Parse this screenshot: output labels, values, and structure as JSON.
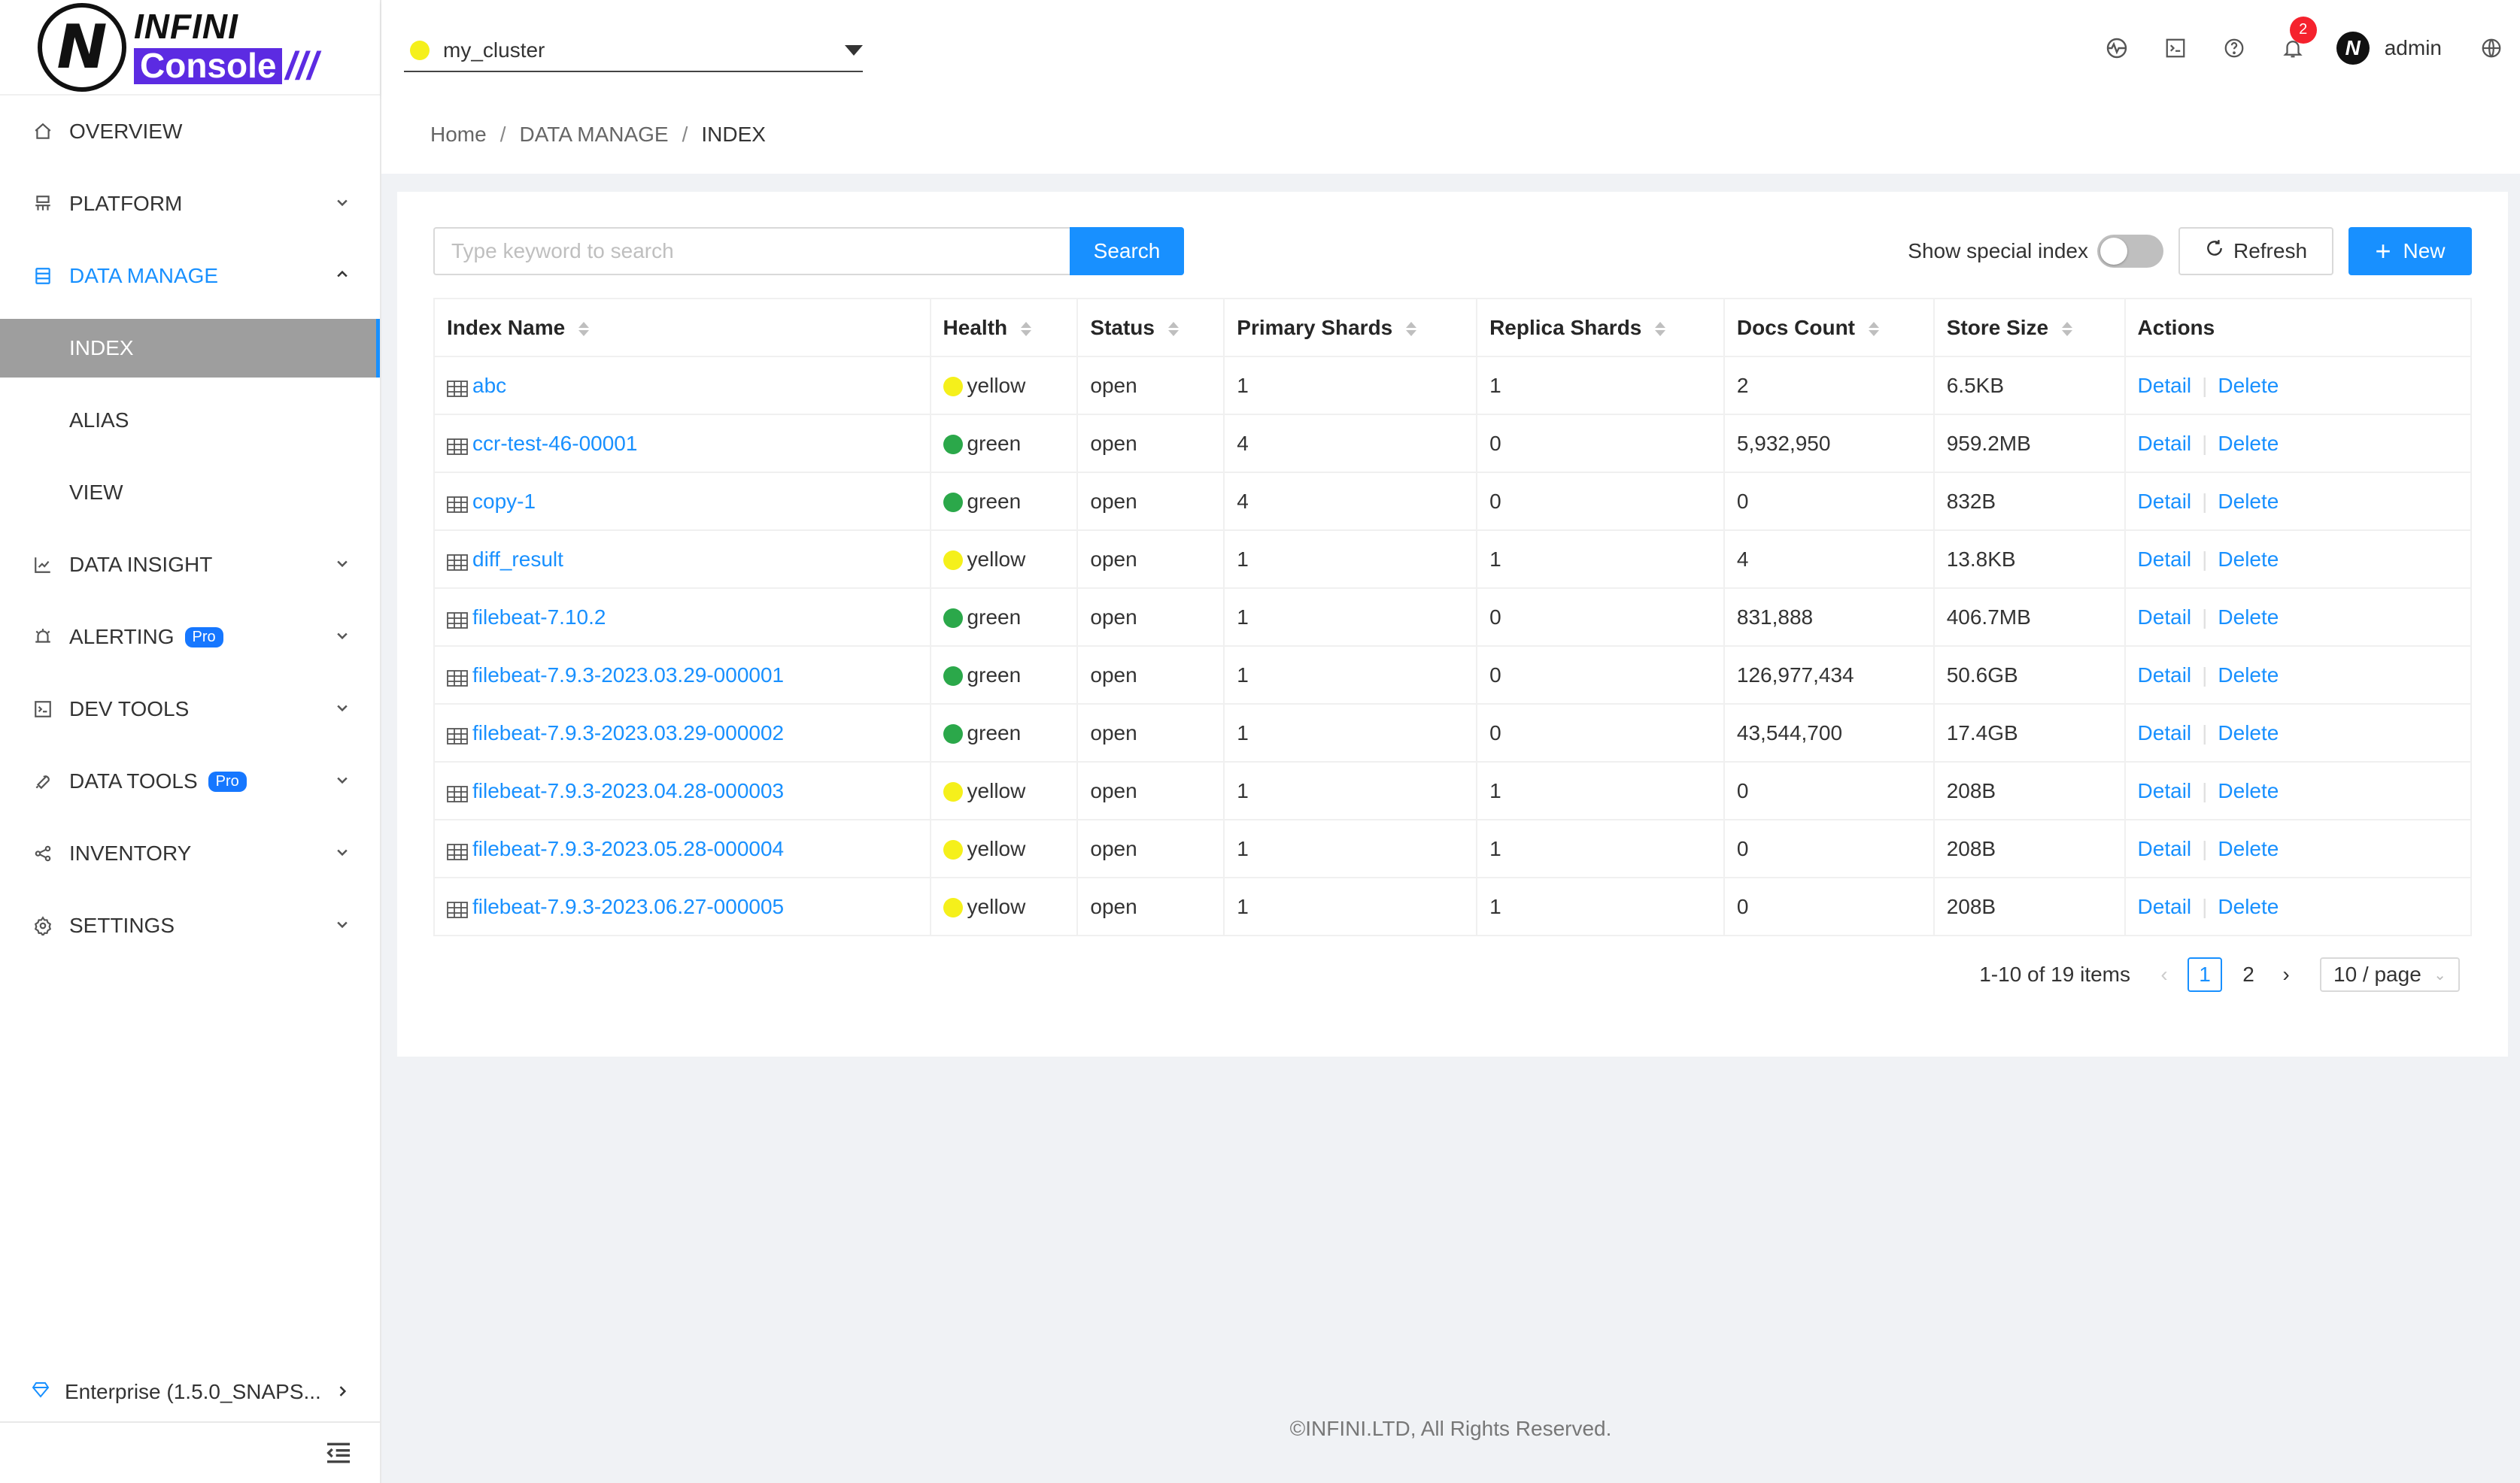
{
  "brand": {
    "top": "INFINI",
    "bottom": "Console",
    "slashes": "///",
    "mark": "N"
  },
  "sidebar": {
    "items": [
      {
        "label": "OVERVIEW",
        "icon": "home-icon"
      },
      {
        "label": "PLATFORM",
        "icon": "platform-icon"
      },
      {
        "label": "DATA MANAGE",
        "icon": "database-icon"
      },
      {
        "label": "DATA INSIGHT",
        "icon": "chart-icon"
      },
      {
        "label": "ALERTING",
        "icon": "alarm-icon",
        "badge": "Pro"
      },
      {
        "label": "DEV TOOLS",
        "icon": "terminal-icon"
      },
      {
        "label": "DATA TOOLS",
        "icon": "wrench-icon",
        "badge": "Pro"
      },
      {
        "label": "INVENTORY",
        "icon": "share-icon"
      },
      {
        "label": "SETTINGS",
        "icon": "gear-icon"
      }
    ],
    "sub_items": [
      "INDEX",
      "ALIAS",
      "VIEW"
    ],
    "footer": "Enterprise (1.5.0_SNAPS..."
  },
  "header": {
    "cluster": "my_cluster",
    "notification_count": "2",
    "user": "admin"
  },
  "breadcrumb": [
    "Home",
    "DATA MANAGE",
    "INDEX"
  ],
  "toolbar": {
    "search_placeholder": "Type keyword to search",
    "search_label": "Search",
    "special_label": "Show special index",
    "refresh_label": "Refresh",
    "new_label": "New"
  },
  "table": {
    "columns": [
      "Index Name",
      "Health",
      "Status",
      "Primary Shards",
      "Replica Shards",
      "Docs Count",
      "Store Size",
      "Actions"
    ],
    "action_labels": {
      "detail": "Detail",
      "delete": "Delete"
    },
    "rows": [
      {
        "name": "abc",
        "health": "yellow",
        "status": "open",
        "primary": "1",
        "replica": "1",
        "docs": "2",
        "size": "6.5KB"
      },
      {
        "name": "ccr-test-46-00001",
        "health": "green",
        "status": "open",
        "primary": "4",
        "replica": "0",
        "docs": "5,932,950",
        "size": "959.2MB"
      },
      {
        "name": "copy-1",
        "health": "green",
        "status": "open",
        "primary": "4",
        "replica": "0",
        "docs": "0",
        "size": "832B"
      },
      {
        "name": "diff_result",
        "health": "yellow",
        "status": "open",
        "primary": "1",
        "replica": "1",
        "docs": "4",
        "size": "13.8KB"
      },
      {
        "name": "filebeat-7.10.2",
        "health": "green",
        "status": "open",
        "primary": "1",
        "replica": "0",
        "docs": "831,888",
        "size": "406.7MB"
      },
      {
        "name": "filebeat-7.9.3-2023.03.29-000001",
        "health": "green",
        "status": "open",
        "primary": "1",
        "replica": "0",
        "docs": "126,977,434",
        "size": "50.6GB"
      },
      {
        "name": "filebeat-7.9.3-2023.03.29-000002",
        "health": "green",
        "status": "open",
        "primary": "1",
        "replica": "0",
        "docs": "43,544,700",
        "size": "17.4GB"
      },
      {
        "name": "filebeat-7.9.3-2023.04.28-000003",
        "health": "yellow",
        "status": "open",
        "primary": "1",
        "replica": "1",
        "docs": "0",
        "size": "208B"
      },
      {
        "name": "filebeat-7.9.3-2023.05.28-000004",
        "health": "yellow",
        "status": "open",
        "primary": "1",
        "replica": "1",
        "docs": "0",
        "size": "208B"
      },
      {
        "name": "filebeat-7.9.3-2023.06.27-000005",
        "health": "yellow",
        "status": "open",
        "primary": "1",
        "replica": "1",
        "docs": "0",
        "size": "208B"
      }
    ]
  },
  "pagination": {
    "total": "1-10 of 19 items",
    "pages": [
      "1",
      "2"
    ],
    "current": "1",
    "page_size": "10 / page"
  },
  "footer": "©INFINI.LTD, All Rights Reserved.",
  "colors": {
    "accent": "#1890ff",
    "brand": "#5c2be2",
    "green": "#2ba84a",
    "yellow": "#f5f01b",
    "active_bg": "#9e9e9e"
  }
}
